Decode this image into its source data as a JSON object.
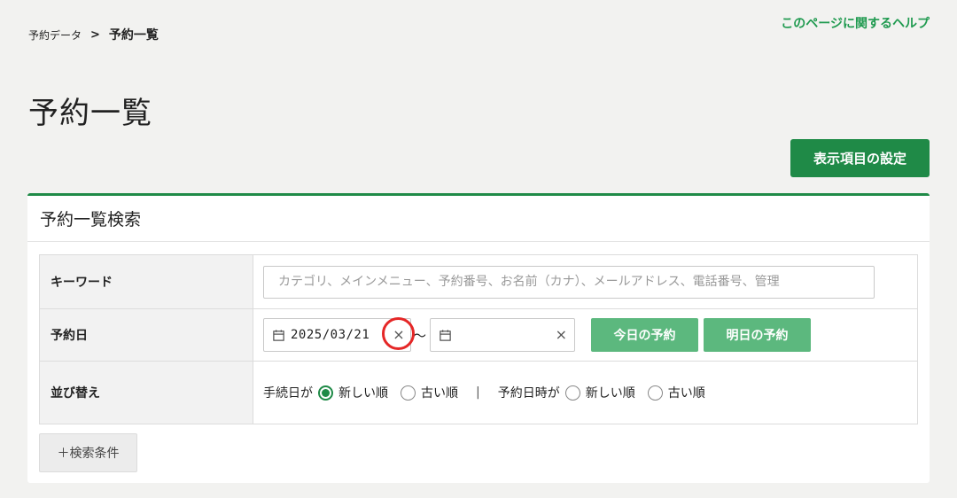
{
  "breadcrumb": {
    "parent": "予約データ",
    "separator": ">",
    "current": "予約一覧"
  },
  "help_link": "このページに関するヘルプ",
  "page_title": "予約一覧",
  "settings_button": "表示項目の設定",
  "search_panel": {
    "title": "予約一覧検索",
    "keyword": {
      "label": "キーワード",
      "value": "",
      "placeholder": "カテゴリ、メインメニュー、予約番号、お名前（カナ）、メールアドレス、電話番号、管理"
    },
    "date": {
      "label": "予約日",
      "from_value": "2025/03/21",
      "to_value": "",
      "tilde": "〜",
      "clear_glyph": "×",
      "today_button": "今日の予約",
      "tomorrow_button": "明日の予約"
    },
    "sort": {
      "label": "並び替え",
      "procedure_label": "手続日が",
      "reservation_label": "予約日時が",
      "separator": "|",
      "newest": "新しい順",
      "oldest": "古い順",
      "procedure_selected": "newest",
      "reservation_selected": "none"
    },
    "add_condition_button": "＋検索条件"
  },
  "colors": {
    "brand_green": "#1f8a47",
    "light_green": "#5cb87e",
    "help_green": "#1f9a4f",
    "highlight_red": "#e52727"
  }
}
